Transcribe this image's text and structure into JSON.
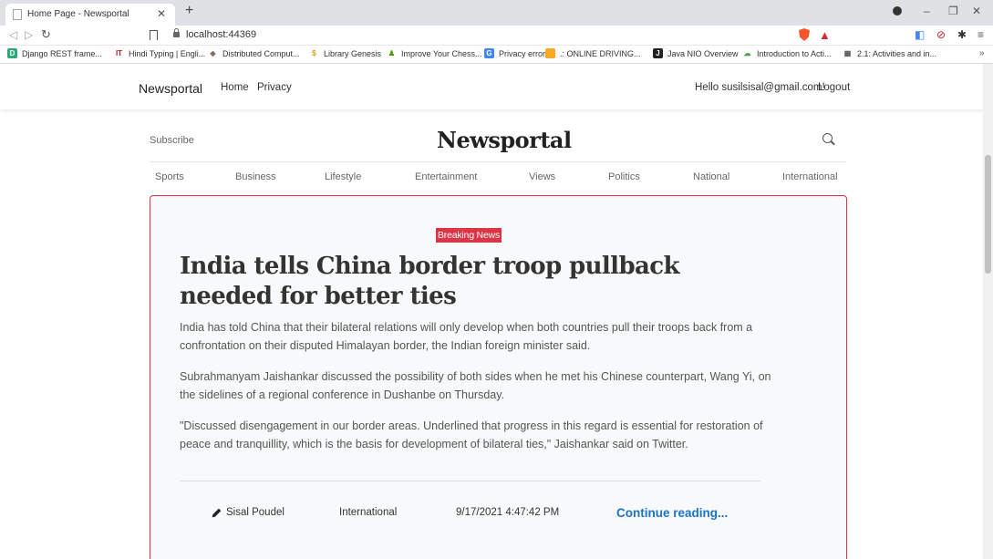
{
  "browser": {
    "tab_title": "Home Page - Newsportal",
    "url": "localhost:44369",
    "bookmarks": [
      {
        "label": "Django REST frame...",
        "icon": "django-icon",
        "color": "#2ba977",
        "glyph": "D"
      },
      {
        "label": "Hindi Typing | Engli...",
        "icon": "hindi-typing-icon",
        "color": "#b71c1c",
        "glyph": "IT"
      },
      {
        "label": "Distributed Comput...",
        "icon": "distributed-icon",
        "color": "#8d6e63",
        "glyph": "◆"
      },
      {
        "label": "Library Genesis",
        "icon": "library-icon",
        "color": "#d4a017",
        "glyph": "$"
      },
      {
        "label": "Improve Your Chess...",
        "icon": "chess-icon",
        "color": "#4e9a06",
        "glyph": "♟"
      },
      {
        "label": "Privacy error",
        "icon": "privacy-icon",
        "color": "#4285f4",
        "glyph": "G"
      },
      {
        "label": ".: ONLINE DRIVING...",
        "icon": "driving-icon",
        "color": "#f9a825",
        "glyph": "▪"
      },
      {
        "label": "Java NIO Overview",
        "icon": "java-icon",
        "color": "#222222",
        "glyph": "J"
      },
      {
        "label": "Introduction to Acti...",
        "icon": "cloud-icon",
        "color": "#43a047",
        "glyph": "☁"
      },
      {
        "label": "2.1: Activities and in...",
        "icon": "book-icon",
        "color": "#555555",
        "glyph": "▦"
      }
    ]
  },
  "site": {
    "brand": "Newsportal",
    "nav": [
      "Home",
      "Privacy"
    ],
    "greeting": "Hello susilsisal@gmail.com!",
    "logout": "Logout"
  },
  "masthead": {
    "subscribe": "Subscribe",
    "title": "Newsportal",
    "categories": [
      "Sports",
      "Business",
      "Lifestyle",
      "Entertainment",
      "Views",
      "Politics",
      "National",
      "International"
    ]
  },
  "article": {
    "badge": "Breaking News",
    "headline": "India tells China border troop pullback needed for better ties",
    "paragraphs": [
      "India has told China that their bilateral relations will only develop when both countries pull their troops back from a confrontation on their disputed Himalayan border, the Indian foreign minister said.",
      "Subrahmanyam Jaishankar discussed the possibility of both sides when he met his Chinese counterpart, Wang Yi, on the sidelines of a regional conference in Dushanbe on Thursday.",
      "\"Discussed disengagement in our border areas. Underlined that progress in this regard is essential for restoration of peace and tranquillity, which is the basis for development of bilateral ties,\" Jaishankar said on Twitter."
    ],
    "author": "Sisal Poudel",
    "category": "International",
    "date": "9/17/2021 4:47:42 PM",
    "continue": "Continue reading..."
  },
  "colors": {
    "accent_red": "#dc3545",
    "link_blue": "#1a73c8",
    "card_bg": "#f8f9fa"
  }
}
